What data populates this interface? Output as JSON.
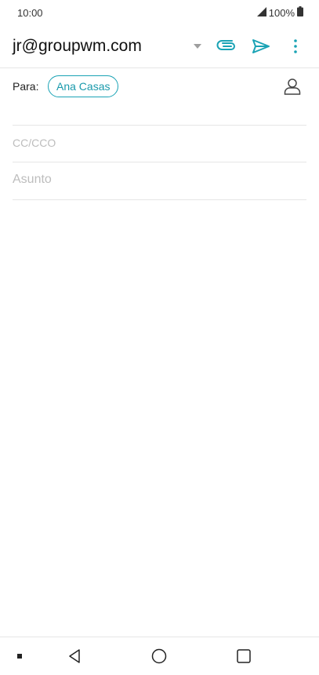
{
  "status": {
    "time": "10:00",
    "battery": "100%",
    "signal_icon": "signal-icon",
    "battery_icon": "battery-icon"
  },
  "header": {
    "from_account": "jr@groupwm.com",
    "dropdown_icon": "dropdown-arrow-icon",
    "attach_icon": "attachment-icon",
    "send_icon": "send-icon",
    "more_icon": "more-vert-icon"
  },
  "compose": {
    "to_label": "Para:",
    "recipient": "Ana Casas",
    "contacts_icon": "person-icon",
    "cc_placeholder": "CC/CCO",
    "subject_placeholder": "Asunto"
  },
  "navigation": {
    "items": [
      "recent-apps-dot-icon",
      "back-icon",
      "home-icon",
      "overview-icon"
    ]
  },
  "colors": {
    "accent": "#1aa3b5",
    "divider": "#e6e6e6",
    "placeholder": "#bdbdbd"
  }
}
